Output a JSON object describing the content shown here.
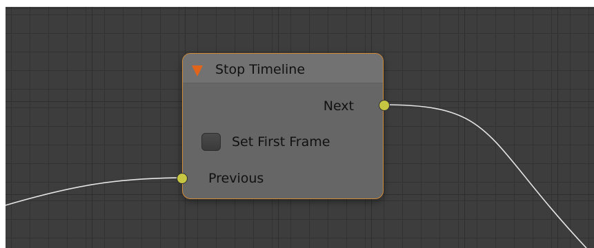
{
  "node": {
    "title": "Stop Timeline",
    "output_socket_label": "Next",
    "checkbox_label": "Set First Frame",
    "checkbox_checked": false,
    "input_socket_label": "Previous"
  },
  "colors": {
    "editor_background": "#3d3d3d",
    "node_border_selected": "#d38c3a",
    "node_body": "#666666",
    "collapse_arrow": "#e0641a",
    "socket": "#c6c643",
    "wire": "#e6e6e6"
  },
  "icons": {
    "collapse": "collapse-triangle-icon",
    "checkbox": "checkbox-icon"
  }
}
